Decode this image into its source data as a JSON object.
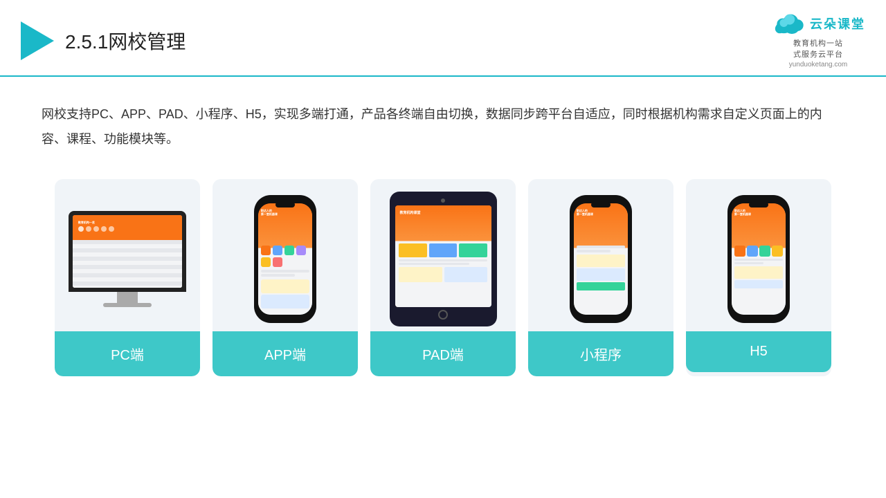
{
  "header": {
    "title_prefix": "2.5.1",
    "title_main": "网校管理",
    "logo_brand": "云朵课堂",
    "logo_url": "yunduoketang.com",
    "logo_tagline": "教育机构一站",
    "logo_tagline2": "式服务云平台"
  },
  "description": {
    "text": "网校支持PC、APP、PAD、小程序、H5，实现多端打通，产品各终端自由切换，数据同步跨平台自适应，同时根据机构需求自定义页面上的内容、课程、功能模块等。"
  },
  "cards": [
    {
      "id": "pc",
      "label": "PC端"
    },
    {
      "id": "app",
      "label": "APP端"
    },
    {
      "id": "pad",
      "label": "PAD端"
    },
    {
      "id": "miniprogram",
      "label": "小程序"
    },
    {
      "id": "h5",
      "label": "H5"
    }
  ]
}
